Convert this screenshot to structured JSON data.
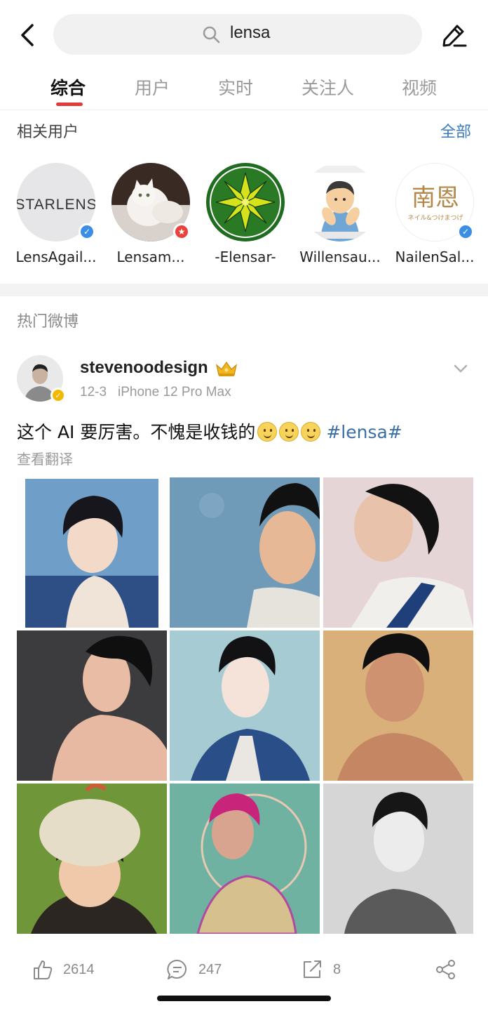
{
  "search": {
    "query": "lensa"
  },
  "tabs": [
    {
      "label": "综合",
      "active": true
    },
    {
      "label": "用户",
      "active": false
    },
    {
      "label": "实时",
      "active": false
    },
    {
      "label": "关注人",
      "active": false
    },
    {
      "label": "视频",
      "active": false
    }
  ],
  "related": {
    "title": "相关用户",
    "all_label": "全部",
    "users": [
      {
        "name": "LensAgail...",
        "badge": "blue-verified"
      },
      {
        "name": "Lensam...",
        "badge": "red-star"
      },
      {
        "name": "-Elensar-",
        "badge": "none"
      },
      {
        "name": "Willensau...",
        "badge": "none"
      },
      {
        "name": "NailenSal...",
        "badge": "blue-verified"
      }
    ],
    "avatar_texts": {
      "starlens": "STARLENS",
      "nailen_big": "南恩",
      "nailen_small": "ネイル&つけまつげ"
    }
  },
  "hot": {
    "title": "热门微博"
  },
  "post": {
    "author": "stevenoodesign",
    "date": "12-3",
    "device": "iPhone 12 Pro Max",
    "text": "这个 AI 要厉害。不愧是收钱的",
    "emoji_count": 3,
    "hashtag": "#lensa#",
    "translate_label": "查看翻译",
    "image_count": 9
  },
  "actions": {
    "likes": "2614",
    "comments": "247",
    "reposts": "8"
  },
  "colors": {
    "accent_red": "#e03a3a",
    "link_blue": "#3a7bbf",
    "hashtag_blue": "#3a6ea8",
    "gray_text": "#9a9a9a",
    "verified_blue": "#3b8ee6",
    "verified_gold": "#f5b800"
  },
  "icons": [
    "back-arrow-icon",
    "search-icon",
    "edit-icon",
    "crown-icon",
    "chevron-down-icon",
    "like-icon",
    "comment-icon",
    "repost-icon",
    "share-icon"
  ]
}
